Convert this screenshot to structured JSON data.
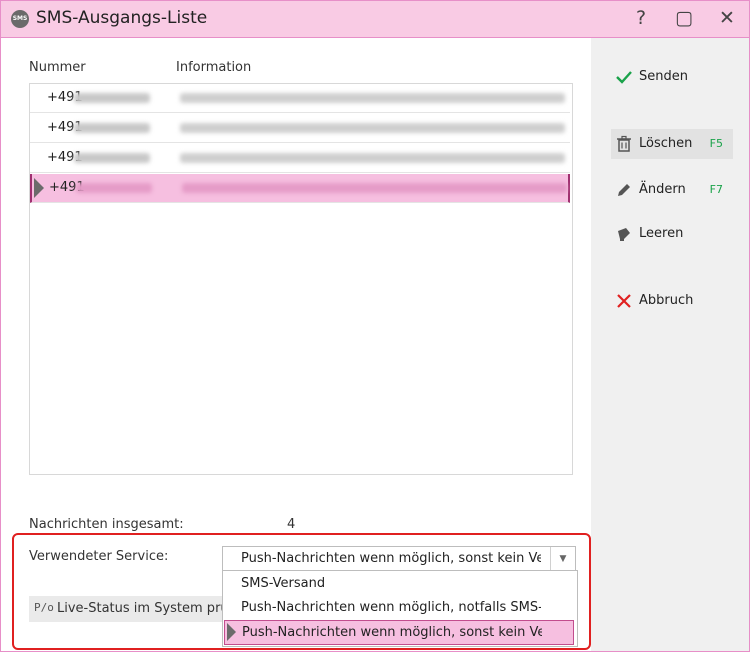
{
  "window": {
    "title": "SMS-Ausgangs-Liste",
    "app_icon_text": "SMS"
  },
  "titlebar_buttons": {
    "help": "?",
    "maximize": "▢",
    "close": "✕"
  },
  "columns": [
    "Nummer",
    "Information"
  ],
  "rows": [
    {
      "number": "+491",
      "selected": false
    },
    {
      "number": "+491",
      "selected": false
    },
    {
      "number": "+491",
      "selected": false
    },
    {
      "number": "+491",
      "selected": true
    }
  ],
  "summary": {
    "label": "Nachrichten insgesamt:",
    "value": "4"
  },
  "service": {
    "label": "Verwendeter Service:",
    "selected": "Push-Nachrichten wenn möglich, sonst kein Versan",
    "options": [
      "SMS-Versand",
      "Push-Nachrichten wenn möglich, notfalls SMS-Vers",
      "Push-Nachrichten wenn möglich, sonst kein Versan"
    ]
  },
  "live_status": {
    "icon_text": "P/o",
    "label": "Live-Status im System prüfen"
  },
  "sidebar": {
    "send": {
      "label": "Senden"
    },
    "delete": {
      "label": "Löschen",
      "key": "F5"
    },
    "edit": {
      "label": "Ändern",
      "key": "F7"
    },
    "clear": {
      "label": "Leeren"
    },
    "cancel": {
      "label": "Abbruch"
    }
  },
  "colors": {
    "accent_pink": "#f6bfe0",
    "titlebar": "#f9cbe4",
    "highlight_red": "#e02020",
    "hotkey_green": "#1aa24a"
  }
}
